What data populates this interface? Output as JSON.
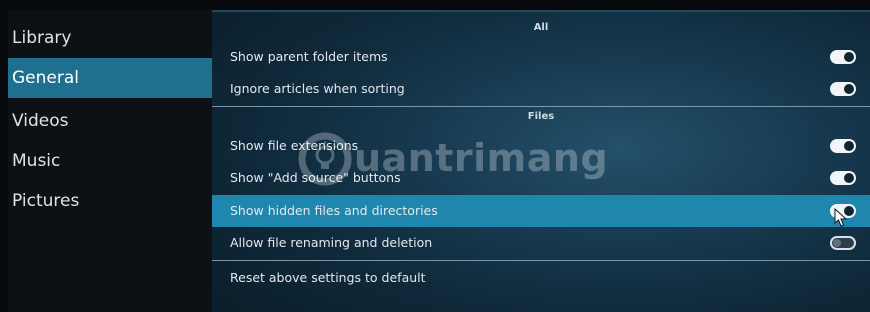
{
  "sidebar": {
    "items": [
      {
        "label": "Library",
        "active": false
      },
      {
        "label": "General",
        "active": true
      },
      {
        "label": "Videos",
        "active": false
      },
      {
        "label": "Music",
        "active": false
      },
      {
        "label": "Pictures",
        "active": false
      }
    ]
  },
  "settings": {
    "groups": [
      {
        "header": "All",
        "rows": [
          {
            "label": "Show parent folder items",
            "state": "on"
          },
          {
            "label": "Ignore articles when sorting",
            "state": "on"
          }
        ]
      },
      {
        "header": "Files",
        "rows": [
          {
            "label": "Show file extensions",
            "state": "on"
          },
          {
            "label": "Show \"Add source\" buttons",
            "state": "on"
          },
          {
            "label": "Show hidden files and directories",
            "state": "on",
            "focused": true
          },
          {
            "label": "Allow file renaming and deletion",
            "state": "off"
          }
        ]
      }
    ],
    "reset_label": "Reset above settings to default"
  },
  "watermark": {
    "text": "uantrimang"
  },
  "colors": {
    "accent": "#1f86ad",
    "sidebar_active": "#1f6f8e",
    "panel_bg": "#173a50"
  }
}
